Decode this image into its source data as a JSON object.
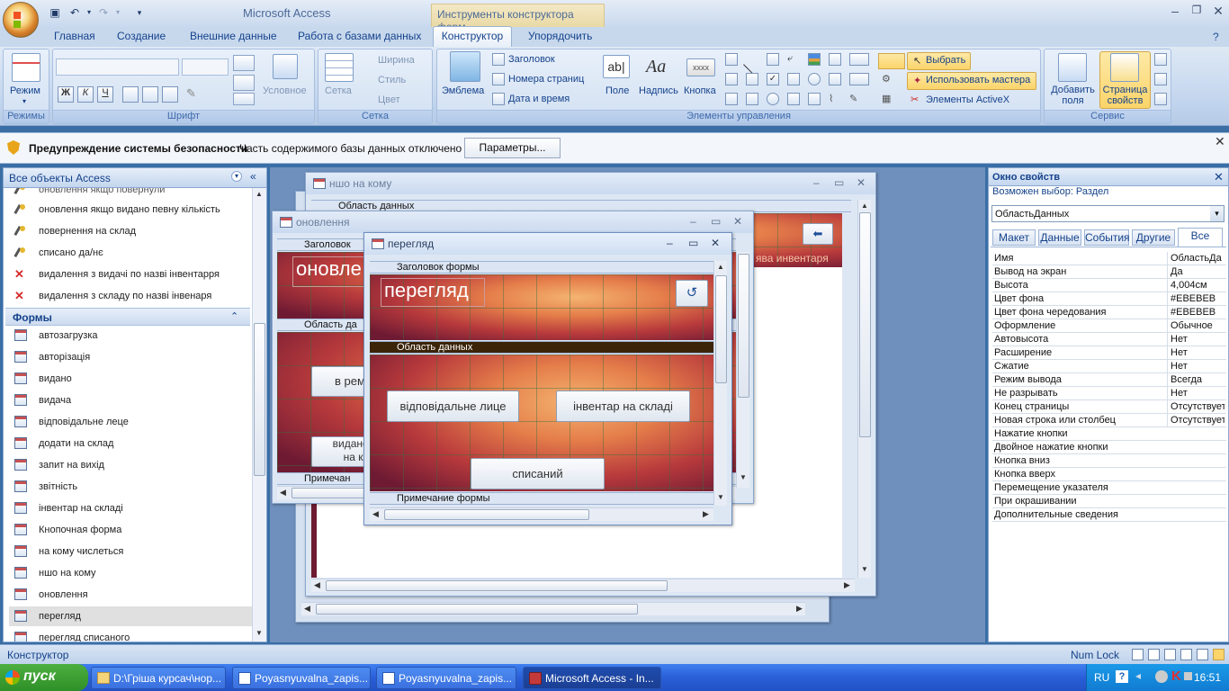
{
  "app": {
    "title": "Microsoft Access",
    "contextual_title": "Инструменты конструктора форм"
  },
  "ribbon_tabs": [
    "Главная",
    "Создание",
    "Внешние данные",
    "Работа с базами данных",
    "Конструктор",
    "Упорядочить"
  ],
  "ribbon": {
    "modes": {
      "group": "Режимы",
      "view": "Режим"
    },
    "font": {
      "group": "Шрифт",
      "conditional": "Условное"
    },
    "grid": {
      "group": "Сетка",
      "grid": "Сетка",
      "width": "Ширина",
      "style": "Стиль",
      "color": "Цвет"
    },
    "controls": {
      "group": "Элементы управления",
      "emblem": "Эмблема",
      "header": "Заголовок",
      "page_numbers": "Номера страниц",
      "date_time": "Дата и время",
      "field": "Поле",
      "label": "Надпись",
      "button": "Кнопка",
      "field_icon_text": "ab|",
      "label_icon_text": "Aa",
      "button_icon_text": "xxxx",
      "select": "Выбрать",
      "use_wizards": "Использовать мастера",
      "activex": "Элементы ActiveX"
    },
    "tools": {
      "group": "Сервис",
      "add_fields": "Добавить\nполя",
      "property_sheet": "Страница\nсвойств"
    }
  },
  "security_bar": {
    "title": "Предупреждение системы безопасности",
    "message": "Часть содержимого базы данных отключено",
    "button": "Параметры..."
  },
  "nav_pane": {
    "header": "Все объекты Access",
    "partial_item": "оновлення якщо повернули",
    "macros": [
      {
        "label": "оновлення якщо видано певну кількість",
        "icon": "macro"
      },
      {
        "label": "повернення на склад",
        "icon": "macro"
      },
      {
        "label": "списано да/нє",
        "icon": "macro"
      },
      {
        "label": "видалення з видачі по назві інвентарря",
        "icon": "delete"
      },
      {
        "label": "видалення з складу по назві інвенаря",
        "icon": "delete"
      }
    ],
    "forms_header": "Формы",
    "forms": [
      "автозагрузка",
      "авторізація",
      "видано",
      "видача",
      "відповідальне леце",
      "додати на склад",
      "запит на вихід",
      "звітність",
      "інвентар на складі",
      "Кнопочная форма",
      "на кому числеться",
      "ншо на кому",
      "оновлення",
      "перегляд",
      "перегляд списаного"
    ],
    "selected_form": "перегляд"
  },
  "windows": {
    "back": {
      "title": "ншо на кому",
      "data_section": "Область данных",
      "partial_text": "ява инвентаря"
    },
    "middle": {
      "title": "оновлення",
      "header_section": "Заголовок",
      "header_text": "оновле",
      "data_section": "Область да",
      "btn1": "в рем",
      "btn2": "видано ін",
      "btn2b": "на ка",
      "footer_section": "Примечан"
    },
    "front": {
      "title": "перегляд",
      "header_section": "Заголовок формы",
      "header_text": "перегляд",
      "data_section": "Область данных",
      "btn_responsible": "відповідальне лице",
      "btn_inventory": "інвентар на складі",
      "btn_written_off": "списаний",
      "footer_section": "Примечание формы"
    }
  },
  "property_sheet": {
    "title": "Окно свойств",
    "selection_label": "Возможен выбор:  Раздел",
    "selected_object": "ОбластьДанных",
    "tabs": [
      "Макет",
      "Данные",
      "События",
      "Другие",
      "Все"
    ],
    "active_tab": "Все",
    "rows": [
      {
        "name": "Имя",
        "value": "ОбластьДа"
      },
      {
        "name": "Вывод на экран",
        "value": "Да"
      },
      {
        "name": "Высота",
        "value": "4,004см"
      },
      {
        "name": "Цвет фона",
        "value": "#EBEBEB"
      },
      {
        "name": "Цвет фона чередования",
        "value": "#EBEBEB"
      },
      {
        "name": "Оформление",
        "value": "Обычное"
      },
      {
        "name": "Автовысота",
        "value": "Нет"
      },
      {
        "name": "Расширение",
        "value": "Нет"
      },
      {
        "name": "Сжатие",
        "value": "Нет"
      },
      {
        "name": "Режим вывода",
        "value": "Всегда"
      },
      {
        "name": "Не разрывать",
        "value": "Нет"
      },
      {
        "name": "Конец страницы",
        "value": "Отсутствует"
      },
      {
        "name": "Новая строка или столбец",
        "value": "Отсутствует"
      },
      {
        "name": "Нажатие кнопки",
        "value": ""
      },
      {
        "name": "Двойное нажатие кнопки",
        "value": ""
      },
      {
        "name": "Кнопка вниз",
        "value": ""
      },
      {
        "name": "Кнопка вверх",
        "value": ""
      },
      {
        "name": "Перемещение указателя",
        "value": ""
      },
      {
        "name": "При окрашивании",
        "value": ""
      },
      {
        "name": "Дополнительные сведения",
        "value": ""
      }
    ]
  },
  "status_bar": {
    "mode": "Конструктор",
    "num_lock": "Num Lock"
  },
  "taskbar": {
    "start": "пуск",
    "tasks": [
      "D:\\Гріша курсач\\нор...",
      "Poyasnyuvalna_zapis...",
      "Poyasnyuvalna_zapis...",
      "Microsoft Access - In..."
    ],
    "lang": "RU",
    "time": "16:51"
  },
  "colors": {
    "accent": "#15428b",
    "selected_bar": "#3b2408",
    "ribbon_highlight": "#fbd46a"
  }
}
